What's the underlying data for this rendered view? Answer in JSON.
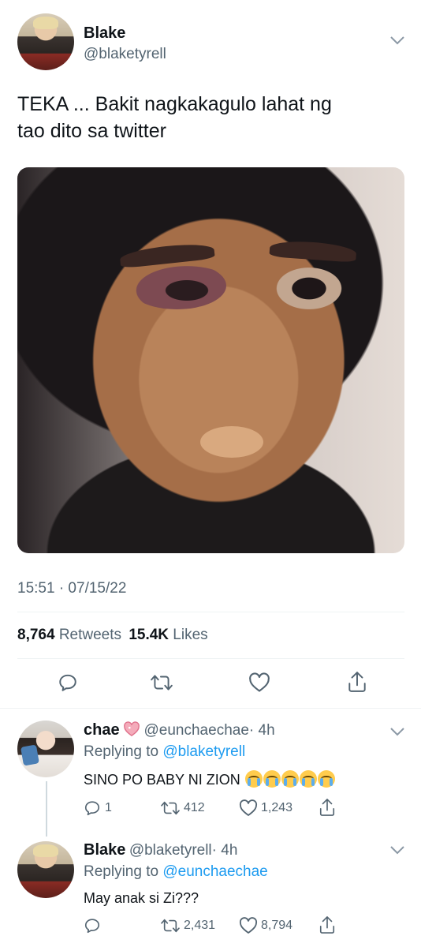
{
  "tweet": {
    "author_name": "Blake",
    "author_handle": "@blaketyrell",
    "text_line1": "TEKA ... Bakit nagkakagulo lahat ng",
    "text_line2": "tao dito sa twitter",
    "timestamp": "15:51 · 07/15/22",
    "retweets_count": "8,764",
    "retweets_label": "Retweets",
    "likes_count": "15.4K",
    "likes_label": "Likes"
  },
  "replies": [
    {
      "author_name": "chae",
      "author_handle": "@eunchaechae",
      "time": "· 4h",
      "replying_prefix": "Replying to",
      "replying_to": "@blaketyrell",
      "text": "SINO PO BABY NI ZION",
      "reply_count": "1",
      "retweet_count": "412",
      "like_count": "1,243"
    },
    {
      "author_name": "Blake",
      "author_handle": "@blaketyrell",
      "time": "· 4h",
      "replying_prefix": "Replying to",
      "replying_to": "@eunchaechae",
      "text": "May anak si Zi???",
      "reply_count": "",
      "retweet_count": "2,431",
      "like_count": "8,794"
    }
  ],
  "icons": {
    "reply": "reply-icon",
    "retweet": "retweet-icon",
    "like": "heart-icon",
    "share": "share-icon",
    "more": "chevron-down-icon",
    "emoji_crying": "loudly-crying-face-emoji",
    "emoji_heart": "sparkling-heart-emoji"
  },
  "colors": {
    "link": "#1d9bf0",
    "muted": "#536471",
    "text": "#0f1419",
    "divider": "#eff3f4",
    "heart_emoji": "#f4abba"
  }
}
